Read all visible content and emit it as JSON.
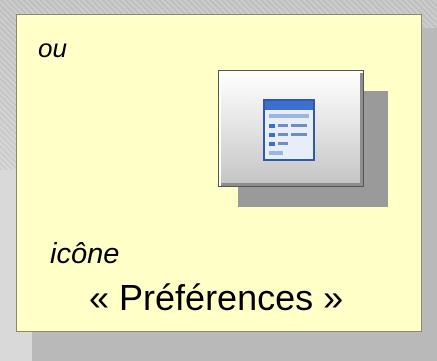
{
  "note": {
    "line1": "ou",
    "line2": "icône",
    "line3": "« Préférences »"
  },
  "icon": {
    "name": "preferences-window-icon",
    "colors": {
      "note_background": "#ffffc8",
      "button_face": "#e6e6e6",
      "glyph_blue": "#3b6fd0"
    }
  }
}
